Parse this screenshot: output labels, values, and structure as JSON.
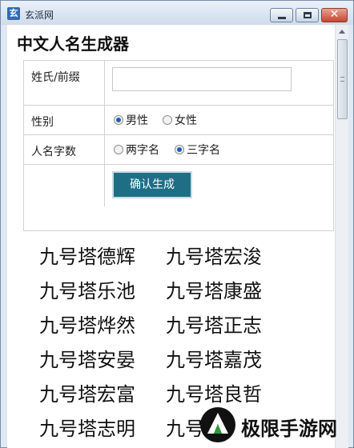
{
  "window": {
    "title": "玄派网",
    "app_icon_glyph": "玄",
    "close_glyph": "✕"
  },
  "page": {
    "title": "中文人名生成器"
  },
  "form": {
    "surname_label": "姓氏/前缀",
    "surname_value": "",
    "gender_label": "性别",
    "gender_options": [
      "男性",
      "女性"
    ],
    "gender_selected": "男性",
    "length_label": "人名字数",
    "length_options": [
      "两字名",
      "三字名"
    ],
    "length_selected": "三字名",
    "generate_label": "确认生成"
  },
  "results": [
    [
      "九号塔德辉",
      "九号塔宏浚"
    ],
    [
      "九号塔乐池",
      "九号塔康盛"
    ],
    [
      "九号塔烨然",
      "九号塔正志"
    ],
    [
      "九号塔安晏",
      "九号塔嘉茂"
    ],
    [
      "九号塔宏富",
      "九号塔良哲"
    ],
    [
      "九号塔志明",
      "九号塔"
    ]
  ],
  "watermark": {
    "text": "极限手游网"
  },
  "colors": {
    "button_bg": "#1e6f86",
    "radio_checked": "#1f5fb8",
    "titlebar": "#cfdceb"
  }
}
